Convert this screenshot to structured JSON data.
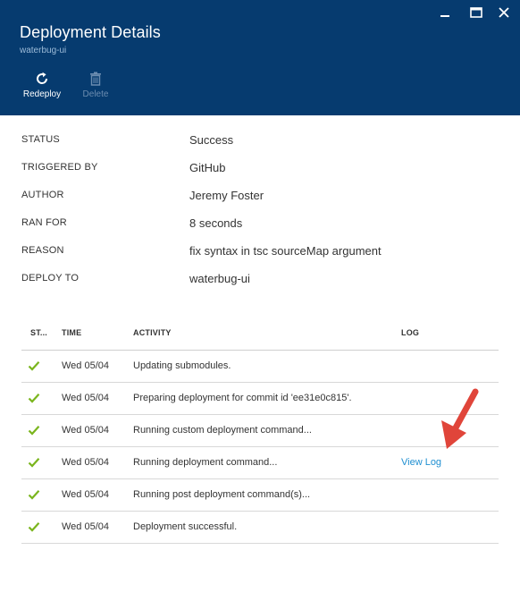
{
  "header": {
    "title": "Deployment Details",
    "subtitle": "waterbug-ui",
    "background": "#063b6f"
  },
  "window_controls": [
    {
      "name": "minimize-icon"
    },
    {
      "name": "maximize-icon"
    },
    {
      "name": "close-icon"
    }
  ],
  "toolbar": {
    "redeploy_label": "Redeploy",
    "redeploy_icon": "refresh-icon",
    "delete_label": "Delete",
    "delete_icon": "trash-icon",
    "delete_enabled": false
  },
  "properties": [
    {
      "key": "STATUS",
      "value": "Success"
    },
    {
      "key": "TRIGGERED BY",
      "value": "GitHub"
    },
    {
      "key": "AUTHOR",
      "value": "Jeremy Foster"
    },
    {
      "key": "RAN FOR",
      "value": "8 seconds"
    },
    {
      "key": "REASON",
      "value": "fix syntax in tsc sourceMap argument"
    },
    {
      "key": "DEPLOY TO",
      "value": "waterbug-ui"
    }
  ],
  "activity_table": {
    "columns": [
      "ST...",
      "TIME",
      "ACTIVITY",
      "LOG"
    ],
    "rows": [
      {
        "status": "success-check-icon",
        "time": "Wed 05/04",
        "activity": "Updating submodules.",
        "log": ""
      },
      {
        "status": "success-check-icon",
        "time": "Wed 05/04",
        "activity": "Preparing deployment for commit id 'ee31e0c815'.",
        "log": ""
      },
      {
        "status": "success-check-icon",
        "time": "Wed 05/04",
        "activity": "Running custom deployment command...",
        "log": ""
      },
      {
        "status": "success-check-icon",
        "time": "Wed 05/04",
        "activity": "Running deployment command...",
        "log": "View Log"
      },
      {
        "status": "success-check-icon",
        "time": "Wed 05/04",
        "activity": "Running post deployment command(s)...",
        "log": ""
      },
      {
        "status": "success-check-icon",
        "time": "Wed 05/04",
        "activity": "Deployment successful.",
        "log": ""
      }
    ]
  },
  "colors": {
    "accent_link": "#1f8fd1",
    "success": "#7ab51d",
    "annotation_arrow": "#e0453a"
  }
}
